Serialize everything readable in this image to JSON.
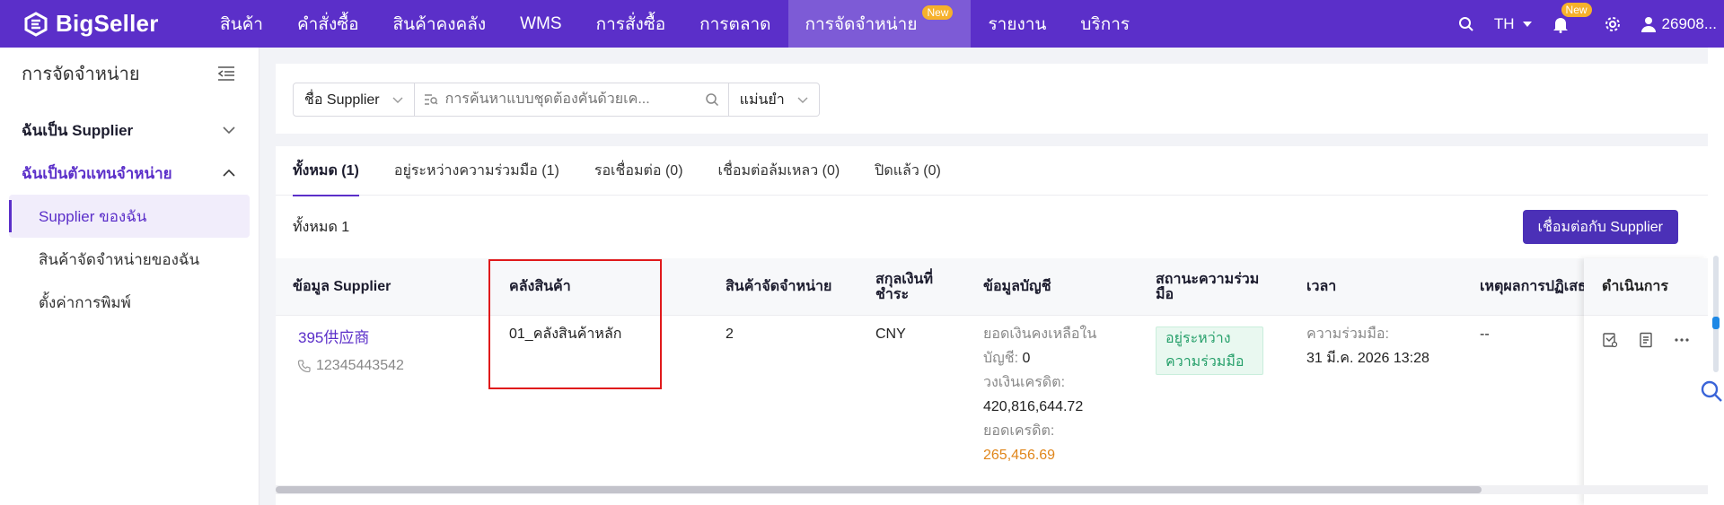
{
  "app": {
    "logo_text": "BigSeller"
  },
  "nav": {
    "items": [
      {
        "label": "สินค้า"
      },
      {
        "label": "คำสั่งซื้อ"
      },
      {
        "label": "สินค้าคงคลัง"
      },
      {
        "label": "WMS"
      },
      {
        "label": "การสั่งซื้อ"
      },
      {
        "label": "การตลาด"
      },
      {
        "label": "การจัดจำหน่าย",
        "badge": "New",
        "active": true
      },
      {
        "label": "รายงาน"
      },
      {
        "label": "บริการ"
      }
    ]
  },
  "topright": {
    "language": "TH",
    "bell_badge": "New",
    "user": "26908..."
  },
  "sidebar": {
    "title": "การจัดจำหน่าย",
    "groups": [
      {
        "label": "ฉันเป็น Supplier"
      },
      {
        "label": "ฉันเป็นตัวแทนจำหน่าย"
      }
    ],
    "items": [
      {
        "label": "Supplier ของฉัน"
      },
      {
        "label": "สินค้าจัดจำหน่ายของฉัน"
      },
      {
        "label": "ตั้งค่าการพิมพ์"
      }
    ]
  },
  "filters": {
    "field_select": "ชื่อ Supplier",
    "search_placeholder": "การค้นหาแบบชุดต้องคั่นด้วยเค...",
    "match_select": "แม่นยำ"
  },
  "tabs": [
    {
      "label": "ทั้งหมด (1)"
    },
    {
      "label": "อยู่ระหว่างความร่วมมือ (1)"
    },
    {
      "label": "รอเชื่อมต่อ (0)"
    },
    {
      "label": "เชื่อมต่อล้มเหลว (0)"
    },
    {
      "label": "ปิดแล้ว (0)"
    }
  ],
  "summary": {
    "total": "ทั้งหมด 1",
    "connect_button": "เชื่อมต่อกับ Supplier"
  },
  "table": {
    "headers": {
      "supplier": "ข้อมูล Supplier",
      "warehouse": "คลังสินค้า",
      "products": "สินค้าจัดจำหน่าย",
      "currency_l1": "สกุลเงินที่",
      "currency_l2": "ชำระ",
      "account": "ข้อมูลบัญชี",
      "status_l1": "สถานะความร่วม",
      "status_l2": "มือ",
      "time": "เวลา",
      "reject": "เหตุผลการปฏิเสธ",
      "actions": "ดำเนินการ"
    },
    "row": {
      "supplier_name": "395供应商",
      "phone": "12345443542",
      "warehouse": "01_คลังสินค้าหลัก",
      "products": "2",
      "currency": "CNY",
      "balance_label_l1": "ยอดเงินคงเหลือใน",
      "balance_label_l2": "บัญชี:",
      "balance_value": "0",
      "credit_limit_label": "วงเงินเครดิต:",
      "credit_limit_value": "420,816,644.72",
      "credit_balance_label": "ยอดเครดิต:",
      "credit_balance_value": "265,456.69",
      "status_l1": "อยู่ระหว่าง",
      "status_l2": "ความร่วมมือ",
      "time_label": "ความร่วมมือ:",
      "time_value": "31 มี.ค. 2026 13:28",
      "reject": "--"
    }
  },
  "colors": {
    "brand": "#5b2fc9",
    "button": "#4b30b7",
    "highlight": "#e0191b",
    "status": "#27a06b",
    "credit": "#e0861b"
  }
}
